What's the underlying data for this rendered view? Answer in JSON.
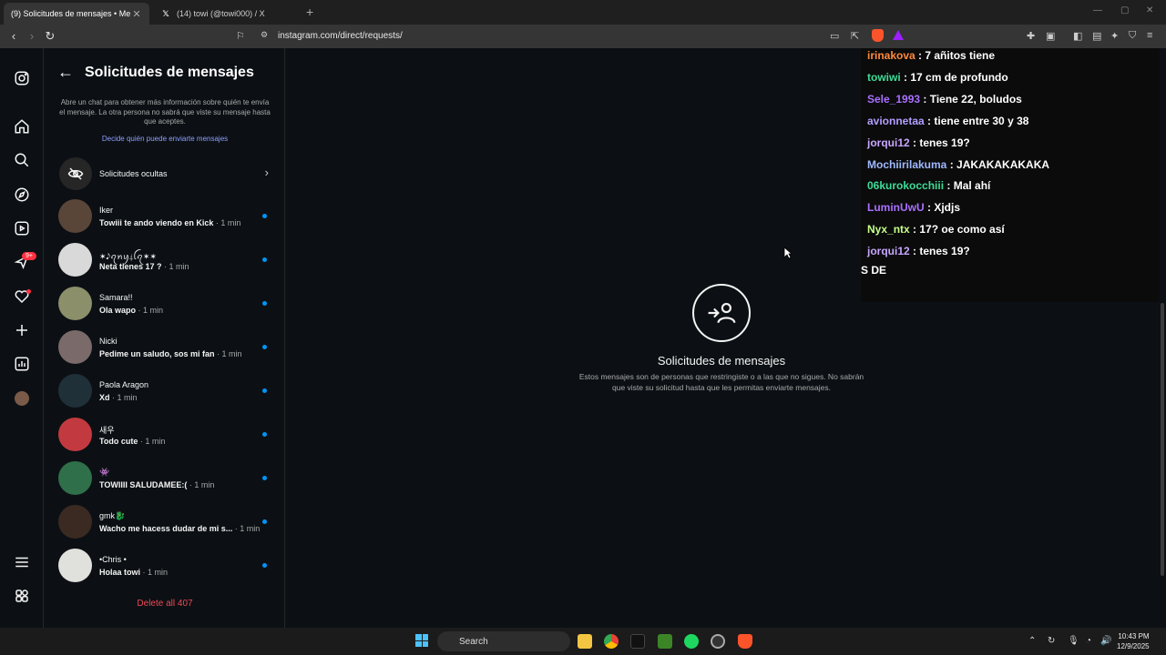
{
  "browser": {
    "tabs": [
      {
        "title": "(9) Solicitudes de mensajes • Me"
      },
      {
        "title": "(14) towi (@towi000) / X"
      }
    ],
    "url": "instagram.com/direct/requests/"
  },
  "panel": {
    "title": "Solicitudes de mensajes",
    "description": "Abre un chat para obtener más información sobre quién te envía el mensaje. La otra persona no sabrá que viste su mensaje hasta que aceptes.",
    "link": "Decide quién puede enviarte mensajes",
    "hidden_requests": "Solicitudes ocultas",
    "delete_all": "Delete all 407"
  },
  "nav": {
    "notification_badge": "9+"
  },
  "requests": [
    {
      "name": "Iker",
      "message": "Towiii te ando viendo en Kick",
      "time": " · 1 min",
      "avatar_color": "#5a4638"
    },
    {
      "name": "✶𝅘𝅥𝅮ꪖꪀꪗ⸸ꪶꪖ✶✶",
      "message": "Neta tienes 17 ?",
      "time": " · 1 min",
      "avatar_color": "#d9d9d9"
    },
    {
      "name": "Samara!!",
      "message": "Ola wapo",
      "time": " · 1 min",
      "avatar_color": "#8b8f6a"
    },
    {
      "name": "Nicki",
      "message": "Pedime un saludo, sos mi fan",
      "time": " · 1 min",
      "avatar_color": "#7a6a6a"
    },
    {
      "name": "Paola Aragon",
      "message": "Xd",
      "time": " · 1 min",
      "avatar_color": "#1f3038"
    },
    {
      "name": "새우",
      "message": "Todo cute",
      "time": " · 1 min",
      "avatar_color": "#c23a40"
    },
    {
      "name": "👾",
      "message": "TOWIIII SALUDAMEE:(",
      "time": " · 1 min",
      "avatar_color": "#2f6f4a"
    },
    {
      "name": "gmk🐉",
      "message": "Wacho me hacess dudar de mi s...",
      "time": " · 1 min",
      "avatar_color": "#3a2a22"
    },
    {
      "name": "•Chris •",
      "message": "Holaa towi",
      "time": " · 1 min",
      "avatar_color": "#e0e0dc"
    }
  ],
  "main": {
    "title": "Solicitudes de mensajes",
    "description": "Estos mensajes son de personas que restringiste o a las que no sigues. No sabrán que viste su solicitud hasta que les permitas enviarte mensajes."
  },
  "stream_chat": [
    {
      "user": "irinakova",
      "text": " : 7 añitos tiene",
      "color": "#ff8a3d"
    },
    {
      "user": "towiwi",
      "text": " : 17 cm de profundo",
      "color": "#3ddc97"
    },
    {
      "user": "Sele_1993",
      "text": " : Tiene 22, boludos",
      "color": "#a970ff"
    },
    {
      "user": "avionnetaa",
      "text": " : tiene entre 30 y 38",
      "color": "#b39dff"
    },
    {
      "user": "jorqui12",
      "text": " : tenes 19?",
      "color": "#c7a6ff"
    },
    {
      "user": "Mochiirilakuma",
      "text": " : JAKAKAKAKAKA",
      "color": "#9fb8ff"
    },
    {
      "user": "06kurokocchiii",
      "text": " : Mal ahí",
      "color": "#3ddc97"
    },
    {
      "user": "LuminUwU",
      "text": " : Xjdjs",
      "color": "#a970ff"
    },
    {
      "user": "Nyx_ntx",
      "text": " : 17? oe como así",
      "color": "#c6ff8a"
    },
    {
      "user": "jorqui12",
      "text": " : tenes 19?",
      "color": "#c7a6ff"
    }
  ],
  "stream_chat_tail": "S DE",
  "taskbar": {
    "search": "Search",
    "time": "10:43 PM",
    "date": "12/9/2025"
  }
}
